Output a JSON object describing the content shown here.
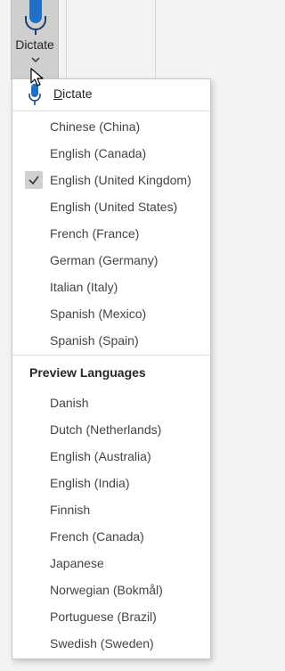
{
  "ribbon": {
    "dictate_label": "Dictate"
  },
  "menu": {
    "top_item": {
      "prefix": "",
      "underlined": "D",
      "rest": "ictate"
    },
    "languages": [
      {
        "label": "Chinese (China)",
        "checked": false
      },
      {
        "label": "English (Canada)",
        "checked": false
      },
      {
        "label": "English (United Kingdom)",
        "checked": true
      },
      {
        "label": "English (United States)",
        "checked": false
      },
      {
        "label": "French (France)",
        "checked": false
      },
      {
        "label": "German (Germany)",
        "checked": false
      },
      {
        "label": "Italian (Italy)",
        "checked": false
      },
      {
        "label": "Spanish (Mexico)",
        "checked": false
      },
      {
        "label": "Spanish (Spain)",
        "checked": false
      }
    ],
    "preview_title": "Preview Languages",
    "preview_languages": [
      {
        "label": "Danish"
      },
      {
        "label": "Dutch (Netherlands)"
      },
      {
        "label": "English (Australia)"
      },
      {
        "label": "English (India)"
      },
      {
        "label": "Finnish"
      },
      {
        "label": "French (Canada)"
      },
      {
        "label": "Japanese"
      },
      {
        "label": "Norwegian (Bokmål)"
      },
      {
        "label": "Portuguese (Brazil)"
      },
      {
        "label": "Swedish (Sweden)"
      }
    ]
  },
  "icons": {
    "microphone": "microphone-icon",
    "chevron": "chevron-down-icon",
    "check": "checkmark-icon",
    "cursor": "mouse-cursor-icon"
  },
  "colors": {
    "mic_blue": "#1f6fc5",
    "mic_dark": "#1d3d6b",
    "selected_bg": "#cfcfcf"
  }
}
